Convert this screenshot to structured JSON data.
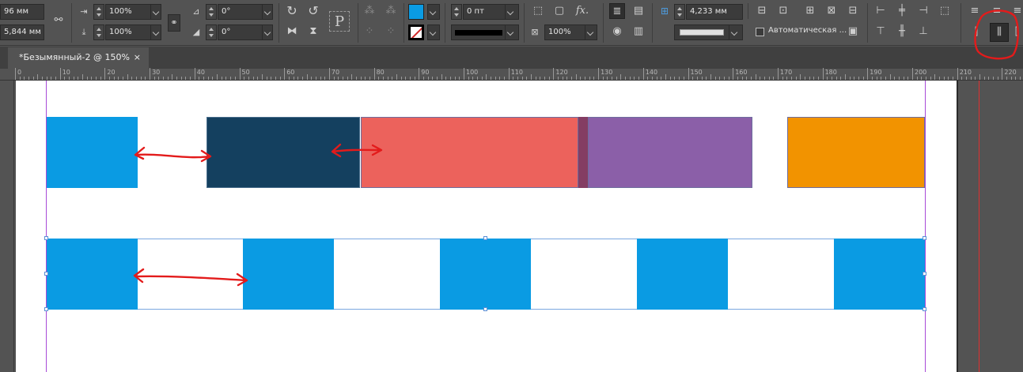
{
  "toolbar": {
    "x_value": "96 мм",
    "y_value": "5,844 мм",
    "scale_x": "100%",
    "scale_y": "100%",
    "rotate_angle": "0°",
    "shear_angle": "0°",
    "stroke_weight": "0 пт",
    "opacity": "100%",
    "spacing_value": "4,233 мм",
    "auto_fit_label": "Автоматическая ...",
    "colors": {
      "fill": "#0a9be3",
      "stroke_swatch": "#000000",
      "stroke_slash": "#d12b2b"
    }
  },
  "document_tab": {
    "title": "*Безымянный-2 @ 150%",
    "close_glyph": "×"
  },
  "ruler": {
    "labels": [
      "0",
      "10",
      "20",
      "30",
      "40",
      "50",
      "60",
      "70",
      "80",
      "90",
      "100",
      "110",
      "120",
      "130",
      "140",
      "150",
      "160",
      "170",
      "180",
      "190",
      "200",
      "210",
      "220"
    ]
  },
  "canvas": {
    "row1_colors": [
      "#0a9be3",
      "#14405f",
      "#ec625c",
      "#843d63",
      "#8b5fa8",
      "#f29300"
    ],
    "row2_color": "#0a9be3",
    "annotation_color": "#e31b1b",
    "margin_guide_color": "#a84bd8",
    "bleed_guide_color": "#e03030"
  }
}
